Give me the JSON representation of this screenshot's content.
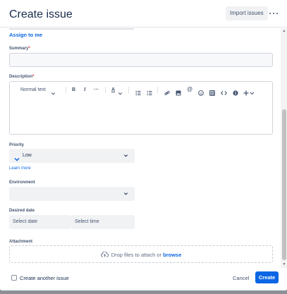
{
  "header": {
    "title": "Create issue",
    "import_label": "Import issues",
    "more_icon": "more-horizontal-icon"
  },
  "assign": {
    "label": "Assign to me"
  },
  "summary": {
    "label": "Summary",
    "required_mark": "*",
    "value": ""
  },
  "description": {
    "label": "Description",
    "required_mark": "*",
    "toolbar": {
      "style_label": "Normal text",
      "bold": "B",
      "italic": "I",
      "more": "···",
      "color": "A",
      "icons": [
        "text-style-chevron-icon",
        "bold-icon",
        "italic-icon",
        "more-formatting-icon",
        "text-color-icon",
        "bullet-list-icon",
        "numbered-list-icon",
        "link-icon",
        "image-icon",
        "mention-icon",
        "emoji-icon",
        "table-icon",
        "code-icon",
        "info-icon",
        "insert-plus-icon"
      ]
    }
  },
  "priority": {
    "label": "Priority",
    "value": "Low",
    "learn_more": "Learn more",
    "colors": {
      "low": "#0c66e4"
    }
  },
  "environment": {
    "label": "Environment",
    "value": ""
  },
  "desired_date": {
    "label": "Desired date",
    "date_placeholder": "Select date",
    "time_placeholder": "Select time"
  },
  "attachment": {
    "label": "Attachment",
    "drop_text": "Drop files to attach or",
    "browse": "browse"
  },
  "footer": {
    "checkbox_label": "Create another issue",
    "checked": false,
    "cancel": "Cancel",
    "create": "Create"
  },
  "colors": {
    "accent": "#0c66e4",
    "required": "#c9372c"
  }
}
